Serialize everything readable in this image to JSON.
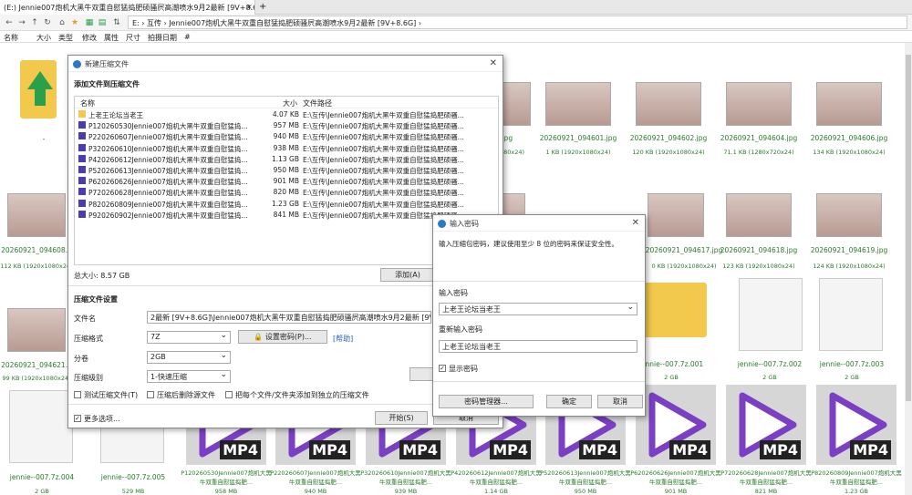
{
  "window": {
    "tab_title": "(E:) Jennie007炮机大黑牛双重自慰猛捣肥硕骚屄高潮喷水9月2最新 [9V+8.6G]",
    "tab_close": "×",
    "tab_add": "+"
  },
  "address": {
    "path": "E: › 互传 › Jennie007炮机大黑牛双重自慰猛捣肥硕骚屄高潮喷水9月2最新 [9V+8.6G] ›"
  },
  "columns": [
    "名称",
    "大小",
    "类型",
    "修改",
    "属性",
    "尺寸",
    "拍摄日期",
    "#"
  ],
  "grid": {
    "row1": [
      {
        "cap": "559.jpg",
        "sz": "(1920x1080x24)"
      },
      {
        "cap": "20260921_094601.jpg",
        "sz": "1 KB (1920x1080x24)"
      },
      {
        "cap": "20260921_094602.jpg",
        "sz": "120 KB (1920x1080x24)"
      },
      {
        "cap": "20260921_094604.jpg",
        "sz": "71.1 KB (1280x720x24)"
      },
      {
        "cap": "20260921_094606.jpg",
        "sz": "134 KB (1920x1080x24)"
      }
    ],
    "left_cap1": "-",
    "left_thumb2_cap": "20260921_094608...",
    "left_thumb2_sz": "112 KB (1920x1080x24)",
    "row2": [
      {
        "cap": "20260921_094617.jpg",
        "sz": "0 KB (1920x1080x24)"
      },
      {
        "cap": "20260921_094618.jpg",
        "sz": "123 KB (1920x1080x24)"
      },
      {
        "cap": "20260921_094619.jpg",
        "sz": "124 KB (1920x1080x24)"
      }
    ],
    "left_thumb3_cap": "20260921_094621...",
    "left_thumb3_sz": "99 KB (1920x1080x24)",
    "row3": [
      {
        "cap": "jennie--007.7z.001",
        "sz": "2 GB"
      },
      {
        "cap": "jennie--007.7z.002",
        "sz": "2 GB"
      },
      {
        "cap": "jennie--007.7z.003",
        "sz": "2 GB"
      }
    ],
    "row4_left": [
      {
        "cap": "jennie--007.7z.004",
        "sz": "2 GB"
      },
      {
        "cap": "jennie--007.7z.005",
        "sz": "529 MB"
      }
    ],
    "mp4s": [
      {
        "cap": "P120260530Jennie007炮机大黑牛双重自慰猛捣肥...",
        "sz": "958 MB"
      },
      {
        "cap": "P220260607Jennie007炮机大黑牛双重自慰猛捣肥...",
        "sz": "940 MB"
      },
      {
        "cap": "P320260610Jennie007炮机大黑牛双重自慰猛捣肥...",
        "sz": "939 MB"
      },
      {
        "cap": "P420260612Jennie007炮机大黑牛双重自慰猛捣肥...",
        "sz": "1.14 GB"
      },
      {
        "cap": "P520260613Jennie007炮机大黑牛双重自慰猛捣肥...",
        "sz": "950 MB"
      },
      {
        "cap": "P620260626Jennie007炮机大黑牛双重自慰猛捣肥...",
        "sz": "901 MB"
      },
      {
        "cap": "P720260628Jennie007炮机大黑牛双重自慰猛捣肥...",
        "sz": "821 MB"
      },
      {
        "cap": "P820260809Jennie007炮机大黑牛双重自慰猛捣肥...",
        "sz": "1.23 GB"
      }
    ],
    "mp4_label": "MP4"
  },
  "compress": {
    "title": "新建压缩文件",
    "section_add": "添加文件到压缩文件",
    "headers": {
      "name": "名称",
      "size": "大小",
      "path": "文件路径"
    },
    "files": [
      {
        "name": "上老王论坛当老王",
        "size": "4.07 KB",
        "path": "E:\\互传\\Jennie007炮机大黑牛双重自慰猛捣肥硕骚..."
      },
      {
        "name": "P120260530Jennie007炮机大黑牛双重自慰猛捣...",
        "size": "957 MB",
        "path": "E:\\互传\\Jennie007炮机大黑牛双重自慰猛捣肥硕骚..."
      },
      {
        "name": "P220260607Jennie007炮机大黑牛双重自慰猛捣...",
        "size": "940 MB",
        "path": "E:\\互传\\Jennie007炮机大黑牛双重自慰猛捣肥硕骚..."
      },
      {
        "name": "P320260610Jennie007炮机大黑牛双重自慰猛捣...",
        "size": "938 MB",
        "path": "E:\\互传\\Jennie007炮机大黑牛双重自慰猛捣肥硕骚..."
      },
      {
        "name": "P420260612Jennie007炮机大黑牛双重自慰猛捣...",
        "size": "1.13 GB",
        "path": "E:\\互传\\Jennie007炮机大黑牛双重自慰猛捣肥硕骚..."
      },
      {
        "name": "P520260613Jennie007炮机大黑牛双重自慰猛捣...",
        "size": "950 MB",
        "path": "E:\\互传\\Jennie007炮机大黑牛双重自慰猛捣肥硕骚..."
      },
      {
        "name": "P620260626Jennie007炮机大黑牛双重自慰猛捣...",
        "size": "901 MB",
        "path": "E:\\互传\\Jennie007炮机大黑牛双重自慰猛捣肥硕骚..."
      },
      {
        "name": "P720260628Jennie007炮机大黑牛双重自慰猛捣...",
        "size": "820 MB",
        "path": "E:\\互传\\Jennie007炮机大黑牛双重自慰猛捣肥硕骚..."
      },
      {
        "name": "P820260809Jennie007炮机大黑牛双重自慰猛捣...",
        "size": "1.23 GB",
        "path": "E:\\互传\\Jennie007炮机大黑牛双重自慰猛捣肥硕骚..."
      },
      {
        "name": "P920260902Jennie007炮机大黑牛双重自慰猛捣...",
        "size": "841 MB",
        "path": "E:\\互传\\Jennie007炮机大黑牛双重自慰猛捣肥硕骚..."
      }
    ],
    "total": "总大小: 8.57 GB",
    "add_btn": "添加(A)",
    "settings_title": "压缩文件设置",
    "filename_label": "文件名",
    "filename_value": "2最新 [9V+8.6G]\\Jennie007炮机大黑牛双重自慰猛捣肥硕骚屄高潮喷水9月2最新 [9V+8.6G].7z",
    "format_label": "压缩格式",
    "format_value": "7Z",
    "setpwd_btn": "设置密码(P)...",
    "help": "[帮助]",
    "split_label": "分卷",
    "split_value": "2GB",
    "level_label": "压缩级别",
    "level_value": "1-快速压缩",
    "opt_test": "测试压缩文件(T)",
    "opt_delete": "压缩后删除源文件",
    "opt_each": "把每个文件/文件夹添加到独立的压缩文件",
    "more": "更多选项...",
    "start_btn": "开始(S)",
    "cancel_btn": "取消"
  },
  "pwd": {
    "title": "输入密码",
    "desc": "输入压缩包密码，建议使用至少 8 位的密码来保证安全性。",
    "enter_label": "输入密码",
    "enter_value": "上老王论坛当老王",
    "reenter_label": "重新输入密码",
    "reenter_value": "上老王论坛当老王",
    "show_label": "显示密码",
    "mgr_btn": "密码管理器...",
    "ok_btn": "确定",
    "cancel_btn": "取消"
  }
}
